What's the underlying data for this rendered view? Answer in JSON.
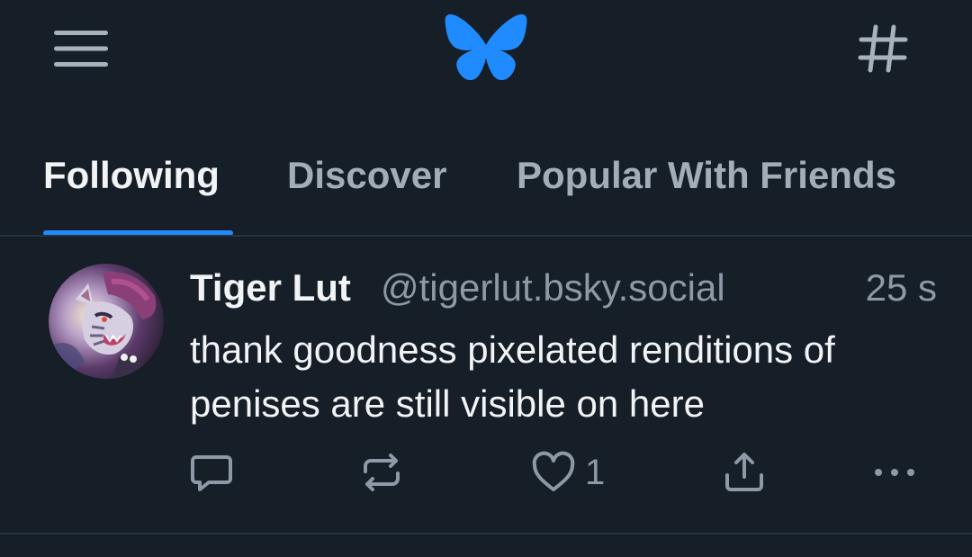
{
  "header": {
    "menu_icon": "hamburger-menu-icon",
    "logo_icon": "butterfly-logo-icon",
    "feeds_icon": "hashtag-icon",
    "brand_color": "#208bfe"
  },
  "tabs": [
    {
      "label": "Following",
      "active": true
    },
    {
      "label": "Discover",
      "active": false
    },
    {
      "label": "Popular With Friends",
      "active": false
    }
  ],
  "post": {
    "display_name": "Tiger Lut",
    "handle": "@tigerlut.bsky.social",
    "timestamp": "25 s",
    "text": "thank goodness pixelated renditions of penises are still visible on here",
    "actions": {
      "reply_icon": "reply-bubble-icon",
      "repost_icon": "repost-icon",
      "like_icon": "heart-icon",
      "like_count": "1",
      "share_icon": "share-icon",
      "more_icon": "more-dots-icon"
    }
  },
  "colors": {
    "background": "#161e27",
    "accent": "#208bfe",
    "text_primary": "#f1f3f5",
    "text_muted": "#8d99a6",
    "divider": "#26323f"
  }
}
